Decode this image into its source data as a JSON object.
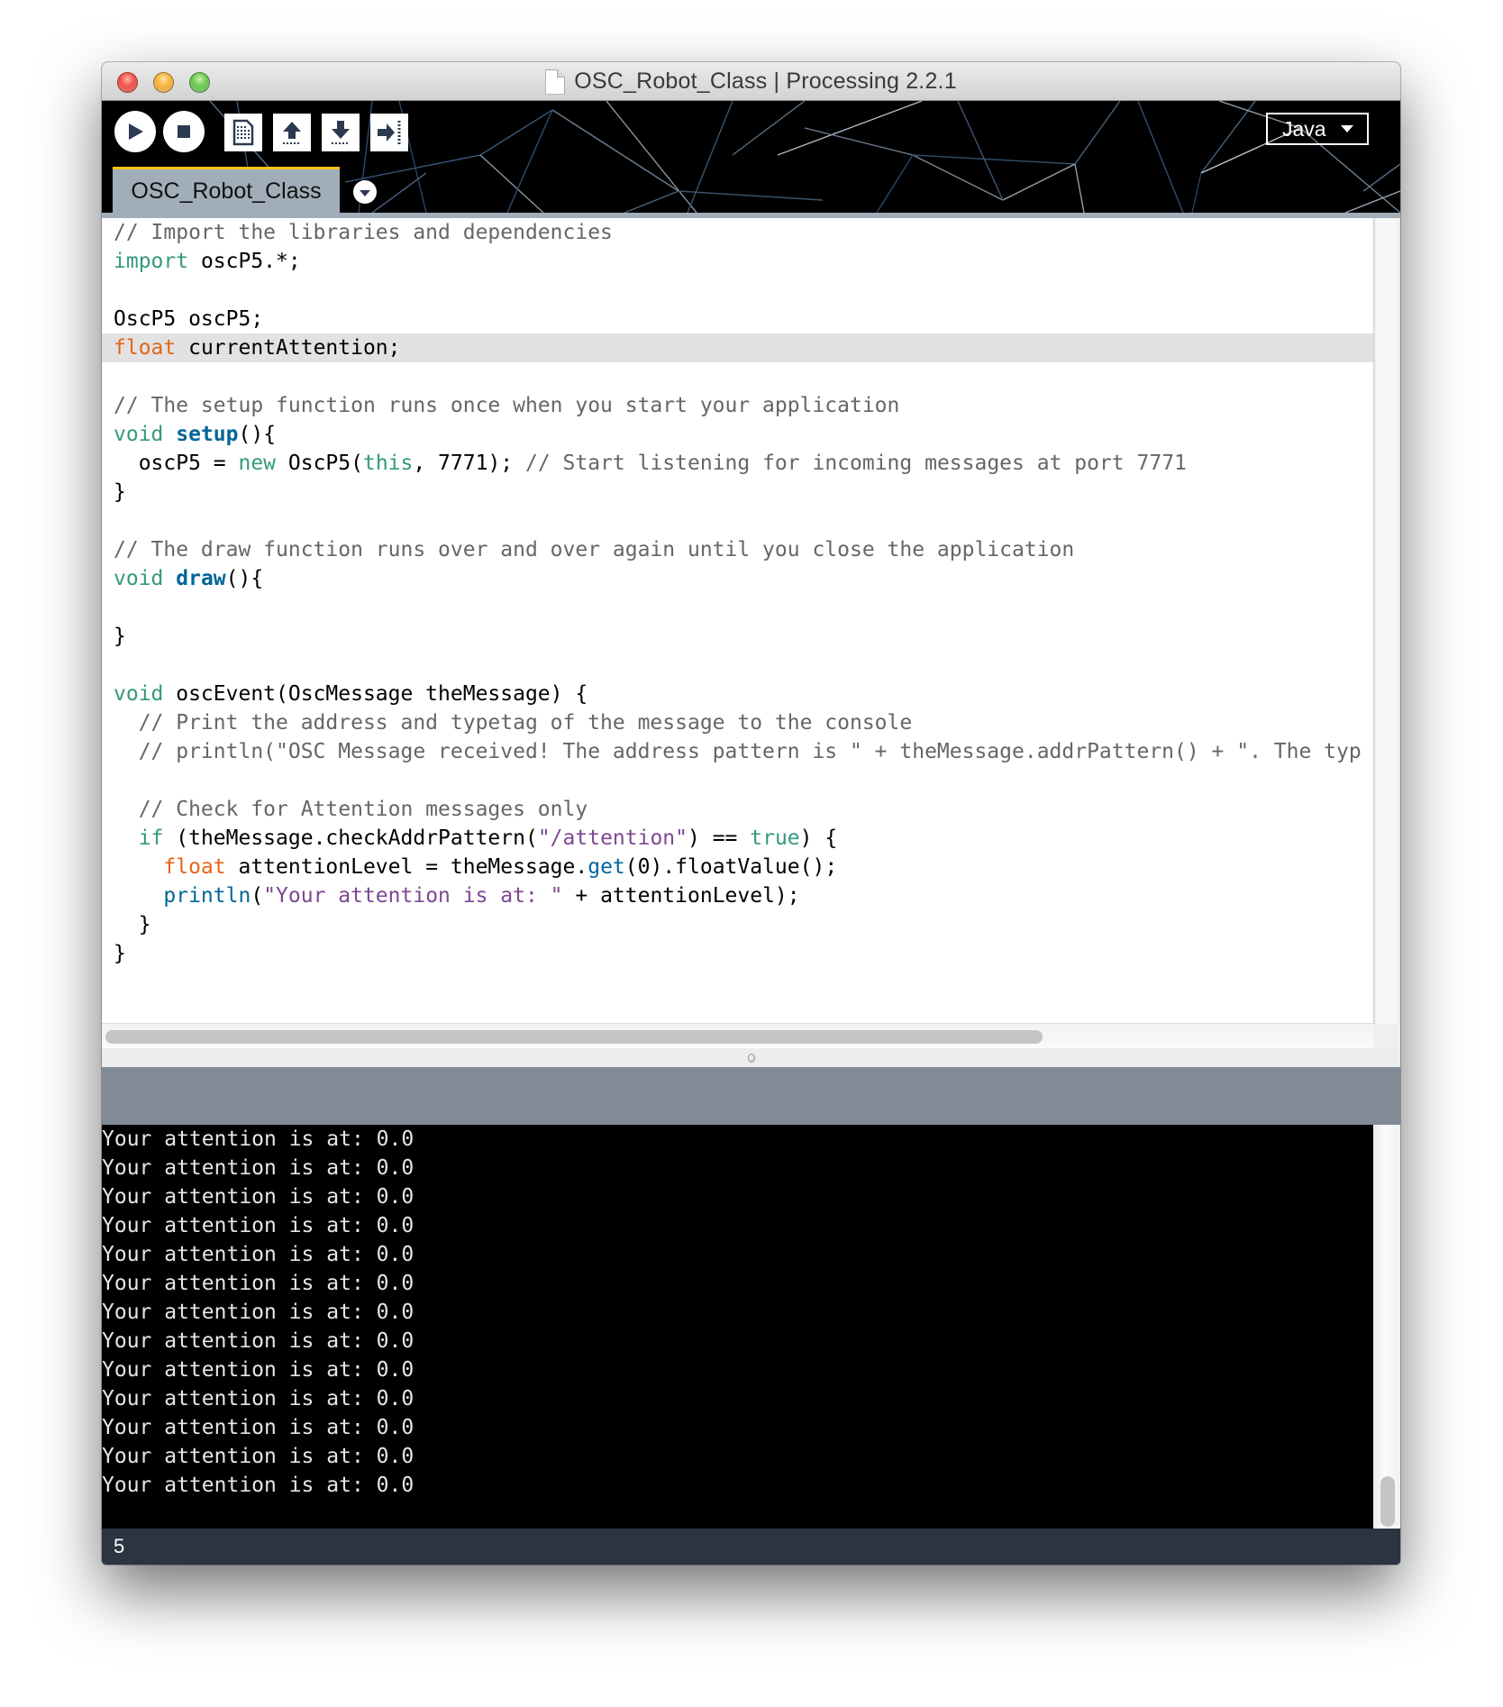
{
  "window": {
    "title": "OSC_Robot_Class | Processing 2.2.1"
  },
  "toolbar": {
    "buttons": [
      {
        "name": "run",
        "icon": "play-icon"
      },
      {
        "name": "stop",
        "icon": "stop-icon"
      },
      {
        "name": "new",
        "icon": "new-file-icon"
      },
      {
        "name": "open",
        "icon": "open-upload-icon"
      },
      {
        "name": "save",
        "icon": "save-download-icon"
      },
      {
        "name": "export",
        "icon": "export-icon"
      }
    ],
    "mode_label": "Java"
  },
  "tabs": [
    {
      "label": "OSC_Robot_Class",
      "active": true
    }
  ],
  "editor": {
    "current_line": 5,
    "lines": [
      [
        {
          "t": "// Import the libraries and dependencies",
          "c": "com"
        }
      ],
      [
        {
          "t": "import",
          "c": "kw"
        },
        {
          "t": " oscP5.*;",
          "c": ""
        }
      ],
      [],
      [
        {
          "t": "OscP5 oscP5;",
          "c": ""
        }
      ],
      [
        {
          "t": "float",
          "c": "type"
        },
        {
          "t": " currentAttention;",
          "c": ""
        }
      ],
      [],
      [
        {
          "t": "// The setup function runs once when you start your application",
          "c": "com"
        }
      ],
      [
        {
          "t": "void",
          "c": "kw"
        },
        {
          "t": " ",
          "c": ""
        },
        {
          "t": "setup",
          "c": "fn"
        },
        {
          "t": "(){",
          "c": ""
        }
      ],
      [
        {
          "t": "  oscP5 = ",
          "c": ""
        },
        {
          "t": "new",
          "c": "kw"
        },
        {
          "t": " OscP5(",
          "c": ""
        },
        {
          "t": "this",
          "c": "kw"
        },
        {
          "t": ", 7771); ",
          "c": ""
        },
        {
          "t": "// Start listening for incoming messages at port 7771",
          "c": "com"
        }
      ],
      [
        {
          "t": "}",
          "c": ""
        }
      ],
      [],
      [
        {
          "t": "// The draw function runs over and over again until you close the application",
          "c": "com"
        }
      ],
      [
        {
          "t": "void",
          "c": "kw"
        },
        {
          "t": " ",
          "c": ""
        },
        {
          "t": "draw",
          "c": "fn"
        },
        {
          "t": "(){",
          "c": ""
        }
      ],
      [],
      [
        {
          "t": "}",
          "c": ""
        }
      ],
      [],
      [
        {
          "t": "void",
          "c": "kw"
        },
        {
          "t": " oscEvent(OscMessage theMessage) {",
          "c": ""
        }
      ],
      [
        {
          "t": "  // Print the address and typetag of the message to the console",
          "c": "com"
        }
      ],
      [
        {
          "t": "  // println(\"OSC Message received! The address pattern is \" + theMessage.addrPattern() + \". The typ",
          "c": "com"
        }
      ],
      [],
      [
        {
          "t": "  // Check for Attention messages only",
          "c": "com"
        }
      ],
      [
        {
          "t": "  ",
          "c": ""
        },
        {
          "t": "if",
          "c": "kw"
        },
        {
          "t": " (theMessage.checkAddrPattern(",
          "c": ""
        },
        {
          "t": "\"/attention\"",
          "c": "str"
        },
        {
          "t": ") == ",
          "c": ""
        },
        {
          "t": "true",
          "c": "kw"
        },
        {
          "t": ") {",
          "c": ""
        }
      ],
      [
        {
          "t": "    ",
          "c": ""
        },
        {
          "t": "float",
          "c": "type"
        },
        {
          "t": " attentionLevel = theMessage.",
          "c": ""
        },
        {
          "t": "get",
          "c": "fn2"
        },
        {
          "t": "(0).floatValue();",
          "c": ""
        }
      ],
      [
        {
          "t": "    ",
          "c": ""
        },
        {
          "t": "println",
          "c": "fn2"
        },
        {
          "t": "(",
          "c": ""
        },
        {
          "t": "\"Your attention is at: \"",
          "c": "str"
        },
        {
          "t": " + attentionLevel);",
          "c": ""
        }
      ],
      [
        {
          "t": "  }",
          "c": ""
        }
      ],
      [
        {
          "t": "}",
          "c": ""
        }
      ]
    ]
  },
  "console": {
    "lines": [
      "Your attention is at: 0.0",
      "Your attention is at: 0.0",
      "Your attention is at: 0.0",
      "Your attention is at: 0.0",
      "Your attention is at: 0.0",
      "Your attention is at: 0.0",
      "Your attention is at: 0.0",
      "Your attention is at: 0.0",
      "Your attention is at: 0.0",
      "Your attention is at: 0.0",
      "Your attention is at: 0.0",
      "Your attention is at: 0.0",
      "Your attention is at: 0.0"
    ]
  },
  "message_bar": {
    "text": ""
  },
  "status_bar": {
    "line_number": "5"
  },
  "colors": {
    "comment": "#666666",
    "keyword": "#33997e",
    "type": "#e2661a",
    "function": "#006699",
    "string": "#7d4793",
    "tab_bg": "#a1adb8",
    "tab_accent": "#f5c416",
    "message_bar": "#818b95",
    "status_bar": "#2b3440"
  }
}
